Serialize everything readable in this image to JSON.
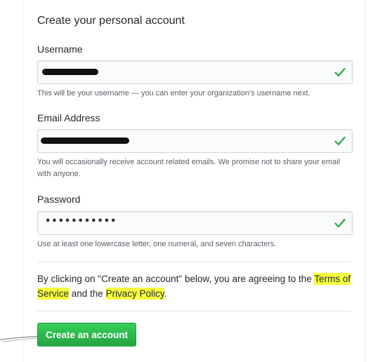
{
  "form": {
    "title": "Create your personal account",
    "username": {
      "label": "Username",
      "hint": "This will be your username — you can enter your organization's username next."
    },
    "email": {
      "label": "Email Address",
      "hint": "You will occasionally receive account related emails. We promise not to share your email with anyone."
    },
    "password": {
      "label": "Password",
      "value": "•••••••••••",
      "hint": "Use at least one lowercase letter, one numeral, and seven characters."
    },
    "agreement": {
      "prefix": "By clicking on \"Create an account\" below, you are agreeing to the ",
      "terms_link": "Terms of Service",
      "middle": " and the ",
      "privacy_link": "Privacy Policy",
      "suffix": "."
    },
    "submit_label": "Create an account"
  },
  "icons": {
    "valid_field": "check-icon",
    "annotation": "hand-drawn-arrow-icon"
  },
  "colors": {
    "check": "#28a745",
    "button": "#2cbe4e",
    "highlight": "#f7ff3c",
    "link": "#0366d6",
    "redaction": "#111111"
  }
}
